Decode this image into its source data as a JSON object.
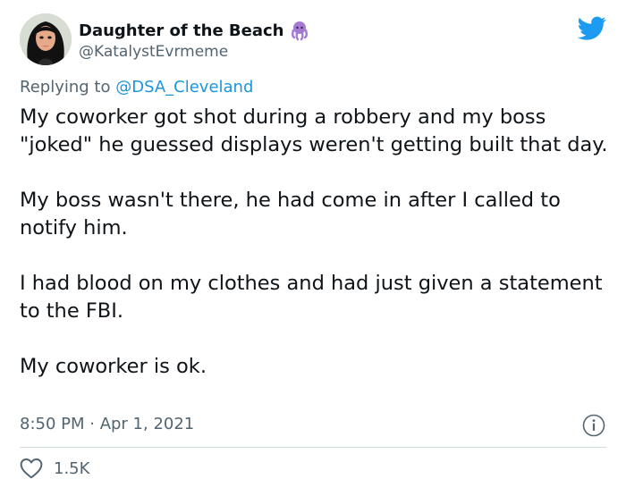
{
  "author": {
    "display_name": "Daughter of the Beach",
    "handle": "@KatalystEvrmeme",
    "emoji_icon": "octopus-emoji",
    "avatar_icon": "profile-avatar"
  },
  "brand": {
    "icon": "twitter-bird-icon",
    "color": "#1d9bf0"
  },
  "reply": {
    "prefix": "Replying to",
    "mention": "@DSA_Cleveland",
    "mention_color": "#1b95e0"
  },
  "tweet": {
    "paragraphs": [
      "My coworker got shot during a robbery and my boss \"joked\" he guessed displays weren't getting built that day.",
      "My boss wasn't there, he had come in after I called to notify him.",
      "I had blood on my clothes and had just given a statement to the FBI.",
      "My coworker is ok."
    ]
  },
  "meta": {
    "timestamp": "8:50 PM · Apr 1, 2021",
    "info_icon": "info-icon"
  },
  "actions": {
    "likes_count": "1.5K",
    "like_icon": "heart-icon"
  },
  "colors": {
    "text": "#0f1419",
    "secondary": "#536471",
    "divider": "#cfd9de",
    "octopus": "#a57ad3"
  }
}
